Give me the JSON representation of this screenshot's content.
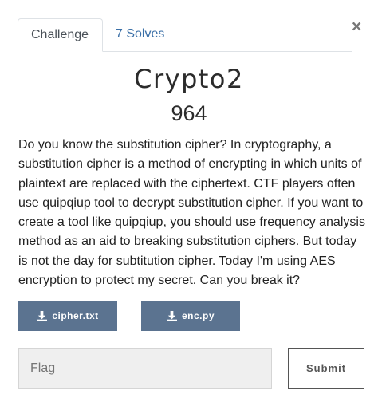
{
  "tabs": [
    {
      "label": "Challenge",
      "active": true
    },
    {
      "label": "7 Solves",
      "active": false
    }
  ],
  "close_label": "×",
  "challenge": {
    "name": "Crypto2",
    "points": "964",
    "description": "Do you know the substitution cipher? In cryptography, a substitution cipher is a method of encrypting in which units of plaintext are replaced with the ciphertext. CTF players often use quipqiup tool to decrypt substitution cipher. If you want to create a tool like quipqiup, you should use frequency analysis method as an aid to breaking substitution ciphers. But today is not the day for subtitution cipher. Today I'm using AES encryption to protect my secret. Can you break it?"
  },
  "files": [
    {
      "label": "cipher.txt",
      "icon": "download-icon"
    },
    {
      "label": "enc.py",
      "icon": "download-icon"
    }
  ],
  "flag_input": {
    "placeholder": "Flag",
    "value": ""
  },
  "submit_label": "Submit",
  "colors": {
    "file_button": "#5b7390",
    "tab_link": "#3a6fa7"
  }
}
